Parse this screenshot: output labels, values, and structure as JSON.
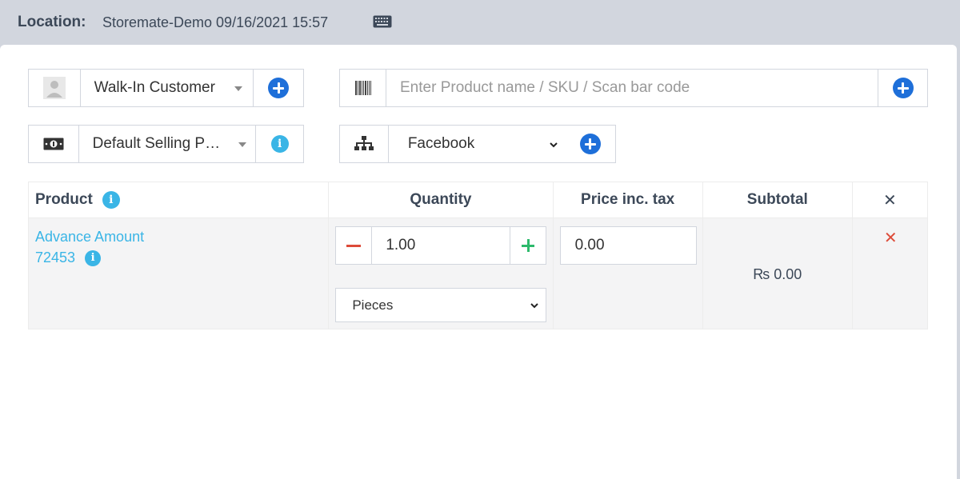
{
  "header": {
    "location_label": "Location:",
    "location_value": "Storemate-Demo  09/16/2021 15:57",
    "keyboard_icon": "keyboard-icon"
  },
  "customer": {
    "icon": "user-icon",
    "selected": "Walk-In Customer",
    "add_icon": "plus-circle-icon"
  },
  "product_search": {
    "icon": "barcode-icon",
    "placeholder": "Enter Product name / SKU / Scan bar code",
    "add_icon": "plus-circle-icon"
  },
  "price_group": {
    "icon": "money-icon",
    "selected": "Default Selling P…",
    "info_icon": "info-icon"
  },
  "channel": {
    "icon": "sitemap-icon",
    "selected": "Facebook",
    "add_icon": "plus-circle-icon"
  },
  "table": {
    "headers": {
      "product": "Product",
      "quantity": "Quantity",
      "price": "Price inc. tax",
      "subtotal": "Subtotal",
      "remove": "✕"
    },
    "rows": [
      {
        "product_name": "Advance Amount",
        "sku": "72453",
        "quantity": "1.00",
        "unit": "Pieces",
        "price": "0.00",
        "subtotal": "₨ 0.00",
        "remove": "✕"
      }
    ]
  },
  "colors": {
    "accent_blue": "#1e6fd9",
    "info_blue": "#3ab5e6",
    "danger_red": "#dd4b39",
    "success_green": "#2dba6c"
  }
}
